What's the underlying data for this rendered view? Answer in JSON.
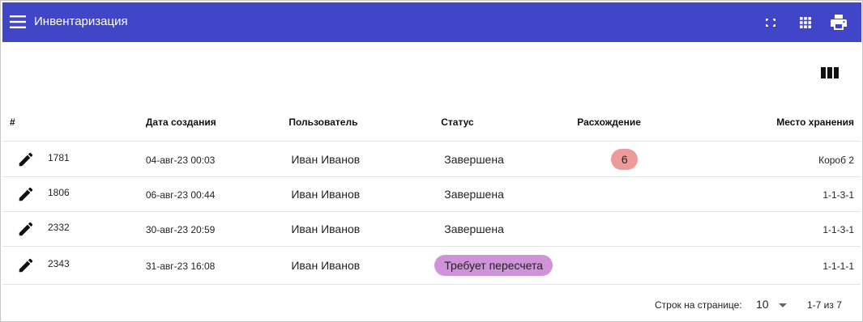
{
  "appbar": {
    "title": "Инвентаризация",
    "icons": [
      "menu-icon",
      "fullscreen-icon",
      "apps-grid-icon",
      "print-icon"
    ]
  },
  "toolbar": {
    "columns_icon": "view-columns-icon"
  },
  "table": {
    "headers": {
      "num": "#",
      "date": "Дата создания",
      "user": "Пользователь",
      "status": "Статус",
      "diff": "Расхождение",
      "place": "Место хранения"
    },
    "rows": [
      {
        "id": "1781",
        "date": "04-авг-23 00:03",
        "user": "Иван Иванов",
        "status": "Завершена",
        "diff": "6",
        "place": "Короб 2"
      },
      {
        "id": "1806",
        "date": "06-авг-23 00:44",
        "user": "Иван Иванов",
        "status": "Завершена",
        "diff": "",
        "place": "1-1-3-1"
      },
      {
        "id": "2332",
        "date": "30-авг-23 20:59",
        "user": "Иван Иванов",
        "status": "Завершена",
        "diff": "",
        "place": "1-1-3-1"
      },
      {
        "id": "2343",
        "date": "31-авг-23 16:08",
        "user": "Иван Иванов",
        "status": "Требует пересчета",
        "diff": "",
        "place": "1-1-1-1"
      }
    ]
  },
  "pagination": {
    "rows_per_page_label": "Строк на странице:",
    "rows_per_page_value": "10",
    "range": "1-7 из 7"
  },
  "colors": {
    "brand": "#4145c8",
    "diff_chip": "#ef9a9a",
    "recount_chip": "#ce93d8"
  }
}
